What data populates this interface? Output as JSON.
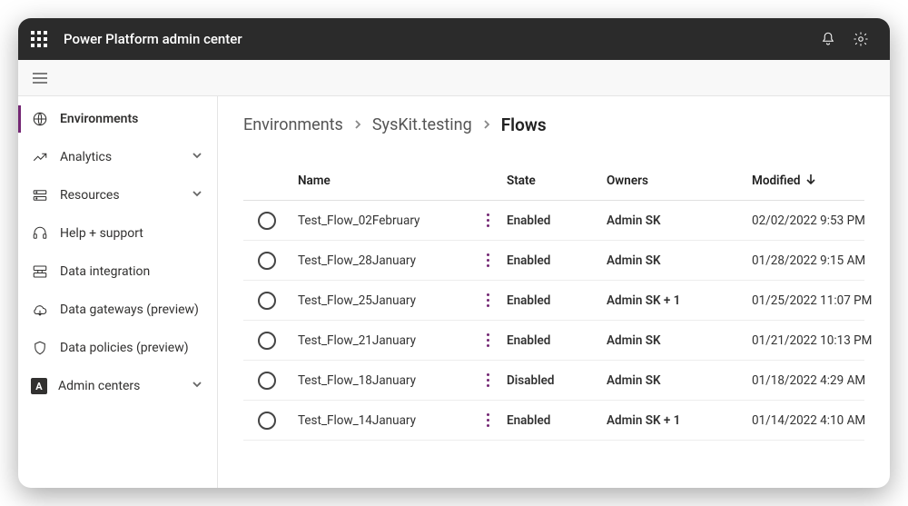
{
  "header": {
    "app_title": "Power Platform admin center"
  },
  "sidebar": {
    "items": [
      {
        "label": "Environments",
        "icon": "globe",
        "expandable": false,
        "selected": true
      },
      {
        "label": "Analytics",
        "icon": "analytics",
        "expandable": true,
        "selected": false
      },
      {
        "label": "Resources",
        "icon": "resources",
        "expandable": true,
        "selected": false
      },
      {
        "label": "Help + support",
        "icon": "headset",
        "expandable": false,
        "selected": false
      },
      {
        "label": "Data integration",
        "icon": "data-int",
        "expandable": false,
        "selected": false
      },
      {
        "label": "Data gateways (preview)",
        "icon": "cloud",
        "expandable": false,
        "selected": false
      },
      {
        "label": "Data policies (preview)",
        "icon": "shield",
        "expandable": false,
        "selected": false
      },
      {
        "label": "Admin centers",
        "icon": "admin-box",
        "expandable": true,
        "selected": false
      }
    ]
  },
  "breadcrumb": {
    "items": [
      {
        "label": "Environments"
      },
      {
        "label": "SysKit.testing"
      },
      {
        "label": "Flows"
      }
    ]
  },
  "table": {
    "columns": {
      "name": "Name",
      "state": "State",
      "owners": "Owners",
      "modified": "Modified"
    },
    "sort": {
      "column": "modified",
      "direction": "desc"
    },
    "rows": [
      {
        "name": "Test_Flow_02February",
        "state": "Enabled",
        "owners": "Admin SK",
        "modified": "02/02/2022 9:53 PM"
      },
      {
        "name": "Test_Flow_28January",
        "state": "Enabled",
        "owners": "Admin SK",
        "modified": "01/28/2022 9:15 AM"
      },
      {
        "name": "Test_Flow_25January",
        "state": "Enabled",
        "owners": "Admin SK + 1",
        "modified": "01/25/2022 11:07 PM"
      },
      {
        "name": "Test_Flow_21January",
        "state": "Enabled",
        "owners": "Admin SK",
        "modified": "01/21/2022 10:13 PM"
      },
      {
        "name": "Test_Flow_18January",
        "state": "Disabled",
        "owners": "Admin SK",
        "modified": "01/18/2022 4:29 AM"
      },
      {
        "name": "Test_Flow_14January",
        "state": "Enabled",
        "owners": "Admin SK + 1",
        "modified": "01/14/2022 4:10 AM"
      }
    ]
  }
}
